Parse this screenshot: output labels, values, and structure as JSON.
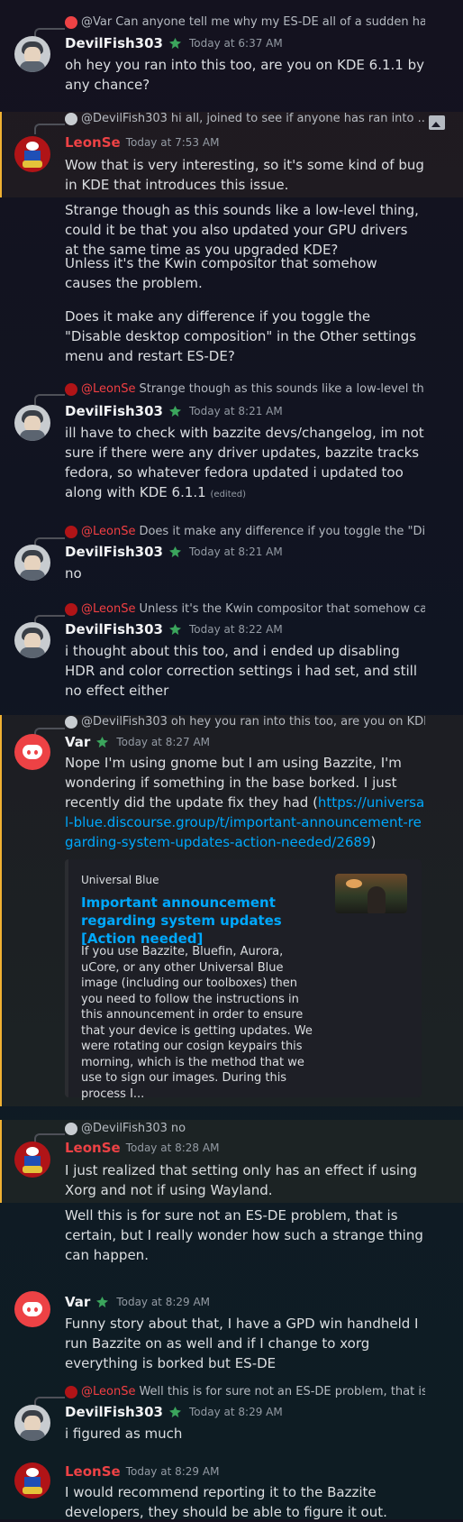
{
  "colors": {
    "accent_link": "#00a8fc",
    "highlight_bar": "#f0b132",
    "username_red": "#ed4245",
    "badge_green": "#3ba55c"
  },
  "messages": [
    {
      "reply_name": "@Var",
      "reply_text": "Can anyone tell me why my ES-DE all of a sudden has ...",
      "author": "DevilFish303",
      "time": "Today at 6:37 AM",
      "lines": [
        "oh hey you ran into this too, are you on KDE 6.1.1 by any chance?"
      ]
    },
    {
      "reply_name": "@DevilFish303",
      "reply_text": "hi all, joined to see if anyone has ran into ...",
      "author": "LeonSe",
      "time": "Today at 7:53 AM",
      "lines": [
        "Wow that is very interesting, so it's some kind of bug in KDE that introduces this issue.",
        "Strange though as this sounds like a low-level thing, could it be that you also updated your GPU drivers at the same time as you upgraded KDE?",
        "Unless it's the Kwin compositor that somehow causes the problem.",
        "Does it make any difference if you toggle the \"Disable desktop composition\" in the Other settings menu and restart ES-DE?"
      ]
    },
    {
      "reply_name": "@LeonSe",
      "reply_text": "Strange though as this sounds like a low-level thin...",
      "author": "DevilFish303",
      "time": "Today at 8:21 AM",
      "lines": [
        "ill have to check with bazzite devs/changelog, im not sure if there were any driver updates, bazzite tracks fedora, so whatever fedora updated i updated too along with KDE 6.1.1"
      ],
      "edited": "(edited)"
    },
    {
      "reply_name": "@LeonSe",
      "reply_text": "Does it make any difference if you toggle the \"Disa...",
      "author": "DevilFish303",
      "time": "Today at 8:21 AM",
      "lines": [
        "no"
      ]
    },
    {
      "reply_name": "@LeonSe",
      "reply_text": "Unless it's the Kwin compositor that somehow cau...",
      "author": "DevilFish303",
      "time": "Today at 8:22 AM",
      "lines": [
        "i thought about this too, and i ended up disabling HDR and color correction settings i had set, and still no effect either"
      ]
    },
    {
      "reply_name": "@DevilFish303",
      "reply_text": "oh hey you ran into this too, are you on KDE ...",
      "author": "Var",
      "time": "Today at 8:27 AM",
      "lines": [
        "Nope I'm using gnome but I am using Bazzite, I'm wondering if something in the base borked.  I just recently did the update fix they had ("
      ],
      "link": "https://universal-blue.discourse.group/t/important-announcement-regarding-system-updates-action-needed/2689",
      "after_link": ")",
      "embed": {
        "provider": "Universal Blue",
        "title": "Important announcement regarding system updates [Action needed]",
        "description": "If you use Bazzite, Bluefin, Aurora, uCore, or any other Universal Blue image (including our toolboxes) then you need to follow the instructions in this announcement in order to ensure that your device is getting updates. We were rotating our cosign keypairs this morning, which is the method that we use to sign our images. During this process I..."
      }
    },
    {
      "reply_name": "@DevilFish303",
      "reply_text": "no",
      "author": "LeonSe",
      "time": "Today at 8:28 AM",
      "lines": [
        "I just realized that setting only has an effect if using Xorg and not if using Wayland.",
        "Well this is for sure not an ES-DE problem, that is certain, but I really wonder how such a strange thing can happen."
      ]
    },
    {
      "author": "Var",
      "time": "Today at 8:29 AM",
      "lines": [
        "Funny story about that, I have a GPD win handheld I run Bazzite on as well and if I change to xorg everything is borked but ES-DE"
      ]
    },
    {
      "reply_name": "@LeonSe",
      "reply_text": "Well this is for sure not an ES-DE problem, that is ...",
      "author": "DevilFish303",
      "time": "Today at 8:29 AM",
      "lines": [
        "i figured as much"
      ]
    },
    {
      "author": "LeonSe",
      "time": "Today at 8:29 AM",
      "lines": [
        "I would recommend reporting it to the Bazzite developers, they should be able to figure it out."
      ]
    }
  ]
}
